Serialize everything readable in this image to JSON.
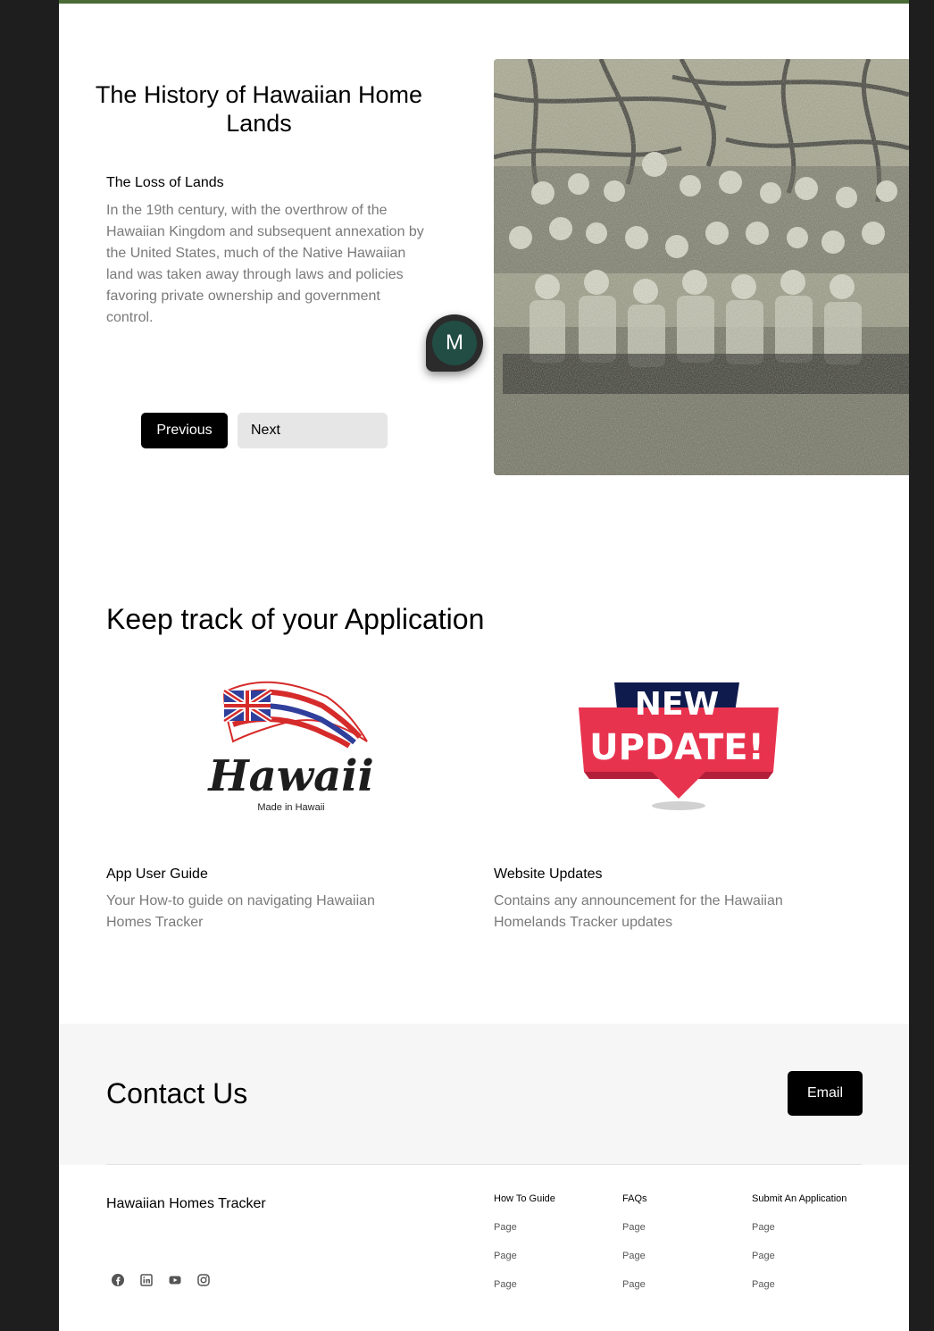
{
  "history": {
    "title": "The History of Hawaiian Home Lands",
    "subheading": "The Loss of Lands",
    "body": "In the 19th century, with the overthrow of the Hawaiian Kingdom and subsequent annexation by the United States, much of the Native Hawaiian land was taken away through laws and policies favoring private ownership and government control.",
    "avatar_initial": "M",
    "prev_label": "Previous",
    "next_label": "Next"
  },
  "track": {
    "title": "Keep track of your Application",
    "cards": [
      {
        "logo_word": "Hawaii",
        "logo_caption": "Made in Hawaii",
        "title": "App User Guide",
        "body": "Your How-to guide on navigating Hawaiian Homes Tracker"
      },
      {
        "logo_line1": "NEW",
        "logo_line2": "UPDATE!",
        "title": "Website Updates",
        "body": "Contains any announcement for the Hawaiian Homelands Tracker updates"
      }
    ]
  },
  "contact": {
    "title": "Contact Us",
    "email_label": "Email"
  },
  "footer": {
    "brand": "Hawaiian Homes Tracker",
    "social_icons": [
      "facebook-icon",
      "linkedin-icon",
      "youtube-icon",
      "instagram-icon"
    ],
    "columns": [
      {
        "heading": "How To Guide",
        "links": [
          "Page",
          "Page",
          "Page"
        ]
      },
      {
        "heading": "FAQs",
        "links": [
          "Page",
          "Page",
          "Page"
        ]
      },
      {
        "heading": "Submit An Application",
        "links": [
          "Page",
          "Page",
          "Page"
        ]
      }
    ]
  },
  "colors": {
    "topbar": "#4a6b35",
    "avatar": "#214d44",
    "update_red": "#e8334f",
    "update_navy": "#0f1b4c"
  }
}
